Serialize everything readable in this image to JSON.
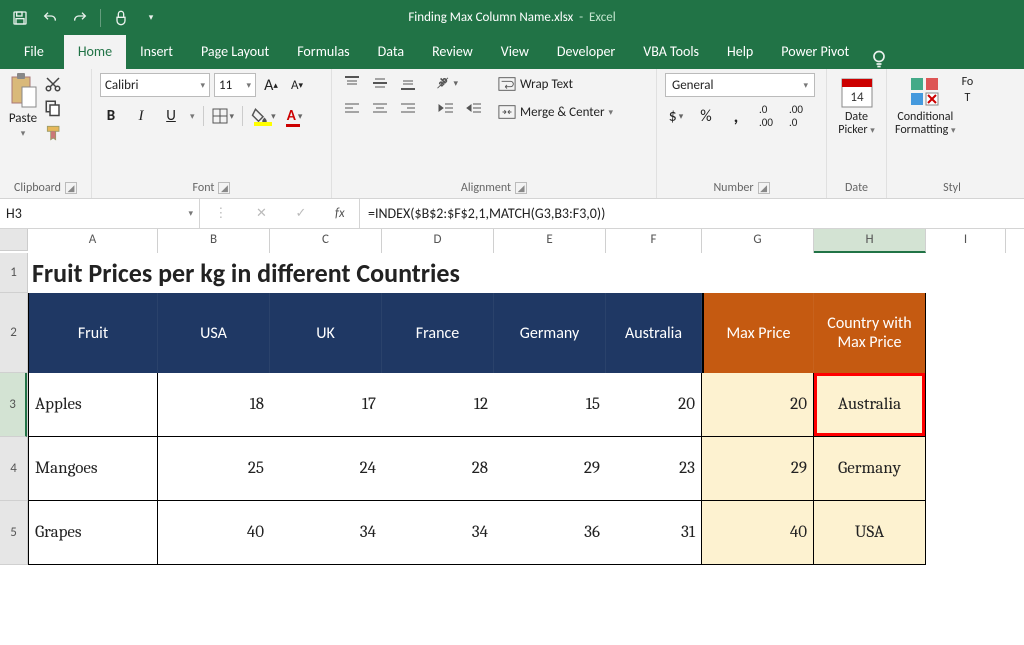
{
  "app": {
    "filename": "Finding Max Column Name.xlsx",
    "appname": "Excel"
  },
  "tabs": {
    "file": "File",
    "home": "Home",
    "insert": "Insert",
    "pagelayout": "Page Layout",
    "formulas": "Formulas",
    "data": "Data",
    "review": "Review",
    "view": "View",
    "developer": "Developer",
    "vbatools": "VBA Tools",
    "help": "Help",
    "powerpivot": "Power Pivot"
  },
  "ribbon": {
    "clipboard": {
      "paste": "Paste",
      "label": "Clipboard"
    },
    "font": {
      "name": "Calibri",
      "size": "11",
      "label": "Font"
    },
    "alignment": {
      "wrap": "Wrap Text",
      "merge": "Merge & Center",
      "label": "Alignment"
    },
    "number": {
      "format": "General",
      "label": "Number"
    },
    "date": {
      "btn": "Date Picker",
      "label": "Date"
    },
    "styles": {
      "cond": "Conditional Formatting",
      "fo": "Fo",
      "t": "T",
      "label": "Styl"
    }
  },
  "formula_bar": {
    "namebox": "H3",
    "formula": "=INDEX($B$2:$F$2,1,MATCH(G3,B3:F3,0))"
  },
  "columns": [
    "A",
    "B",
    "C",
    "D",
    "E",
    "F",
    "G",
    "H",
    "I"
  ],
  "rows": [
    "1",
    "2",
    "3",
    "4",
    "5"
  ],
  "title": "Fruit Prices per kg in different Countries",
  "headers": {
    "fruit": "Fruit",
    "usa": "USA",
    "uk": "UK",
    "france": "France",
    "germany": "Germany",
    "australia": "Australia",
    "maxprice": "Max Price",
    "country": "Country with Max Price"
  },
  "data": [
    {
      "fruit": "Apples",
      "usa": "18",
      "uk": "17",
      "france": "12",
      "germany": "15",
      "australia": "20",
      "max": "20",
      "country": "Australia"
    },
    {
      "fruit": "Mangoes",
      "usa": "25",
      "uk": "24",
      "france": "28",
      "germany": "29",
      "australia": "23",
      "max": "29",
      "country": "Germany"
    },
    {
      "fruit": "Grapes",
      "usa": "40",
      "uk": "34",
      "france": "34",
      "germany": "36",
      "australia": "31",
      "max": "40",
      "country": "USA"
    }
  ],
  "chart_data": {
    "type": "table",
    "title": "Fruit Prices per kg in different Countries",
    "columns": [
      "Fruit",
      "USA",
      "UK",
      "France",
      "Germany",
      "Australia",
      "Max Price",
      "Country with Max Price"
    ],
    "rows": [
      [
        "Apples",
        18,
        17,
        12,
        15,
        20,
        20,
        "Australia"
      ],
      [
        "Mangoes",
        25,
        24,
        28,
        29,
        23,
        29,
        "Germany"
      ],
      [
        "Grapes",
        40,
        34,
        34,
        36,
        31,
        40,
        "USA"
      ]
    ]
  }
}
